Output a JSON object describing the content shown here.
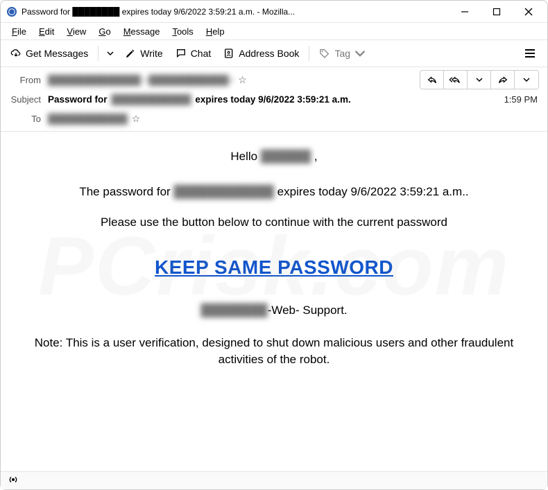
{
  "window": {
    "title": "Password for ████████ expires today 9/6/2022 3:59:21 a.m. - Mozilla..."
  },
  "menu": {
    "file": "File",
    "edit": "Edit",
    "view": "View",
    "go": "Go",
    "message": "Message",
    "tools": "Tools",
    "help": "Help"
  },
  "toolbar": {
    "get_messages": "Get Messages",
    "write": "Write",
    "chat": "Chat",
    "address_book": "Address Book",
    "tag": "Tag"
  },
  "headers": {
    "from_label": "From",
    "from_value": "██████████████  <████████████>",
    "subject_label": "Subject",
    "subject_prefix": "Password for ",
    "subject_redacted": "████████████",
    "subject_suffix": " expires today 9/6/2022 3:59:21 a.m.",
    "to_label": "To",
    "to_value": "████████████",
    "time": "1:59 PM"
  },
  "body": {
    "greeting_prefix": "Hello ",
    "greeting_name_redacted": "██████",
    "greeting_suffix": " ,",
    "pw_line_prefix": "The password for ",
    "pw_line_redacted": "████████████",
    "pw_line_suffix": " expires today 9/6/2022 3:59:21 a.m..",
    "instruction": "Please use the button below to continue with the current password",
    "cta": "KEEP SAME PASSWORD",
    "support_redacted": "████████",
    "support_suffix": "-Web- Support.",
    "note": "Note: This is a user verification, designed to shut down malicious users and other fraudulent activities of the robot."
  },
  "watermark": "PCrisk.com"
}
